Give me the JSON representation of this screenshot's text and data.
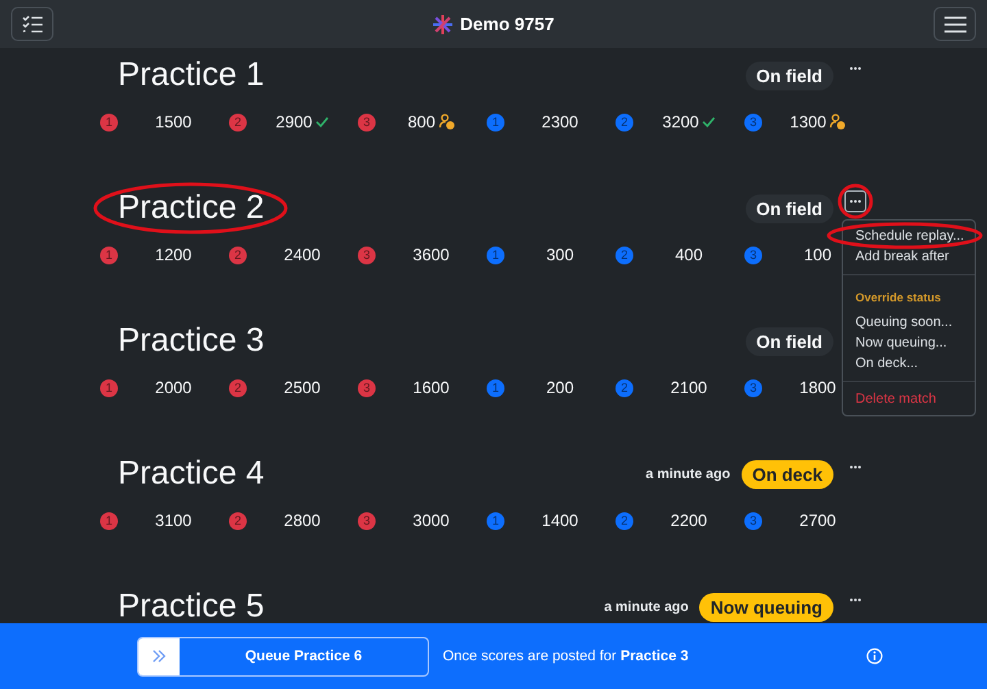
{
  "header": {
    "title": "Demo 9757"
  },
  "matches": [
    {
      "title": "Practice 1",
      "title_circled": false,
      "status": {
        "label": "On field",
        "kind": "dark"
      },
      "menu_open": false,
      "menu_circled": false,
      "scores": [
        {
          "color": "#dc3545",
          "station": "1",
          "value": "1500",
          "kind": "plain"
        },
        {
          "color": "#dc3545",
          "station": "2",
          "value": "2900",
          "kind": "check"
        },
        {
          "color": "#dc3545",
          "station": "3",
          "value": "800",
          "kind": "person"
        },
        {
          "color": "#0d6efd",
          "station": "1",
          "value": "2300",
          "kind": "plain"
        },
        {
          "color": "#0d6efd",
          "station": "2",
          "value": "3200",
          "kind": "check"
        },
        {
          "color": "#0d6efd",
          "station": "3",
          "value": "1300",
          "kind": "person"
        }
      ]
    },
    {
      "title": "Practice 2",
      "title_circled": true,
      "status": {
        "label": "On field",
        "kind": "dark"
      },
      "menu_open": true,
      "menu_circled": true,
      "scores": [
        {
          "color": "#dc3545",
          "station": "1",
          "value": "1200",
          "kind": "plain"
        },
        {
          "color": "#dc3545",
          "station": "2",
          "value": "2400",
          "kind": "plain"
        },
        {
          "color": "#dc3545",
          "station": "3",
          "value": "3600",
          "kind": "plain"
        },
        {
          "color": "#0d6efd",
          "station": "1",
          "value": "300",
          "kind": "plain"
        },
        {
          "color": "#0d6efd",
          "station": "2",
          "value": "400",
          "kind": "plain"
        },
        {
          "color": "#0d6efd",
          "station": "3",
          "value": "100",
          "kind": "plain"
        }
      ]
    },
    {
      "title": "Practice 3",
      "title_circled": false,
      "status": {
        "label": "On field",
        "kind": "dark"
      },
      "scores": [
        {
          "color": "#dc3545",
          "station": "1",
          "value": "2000",
          "kind": "plain"
        },
        {
          "color": "#dc3545",
          "station": "2",
          "value": "2500",
          "kind": "plain"
        },
        {
          "color": "#dc3545",
          "station": "3",
          "value": "1600",
          "kind": "plain"
        },
        {
          "color": "#0d6efd",
          "station": "1",
          "value": "200",
          "kind": "plain"
        },
        {
          "color": "#0d6efd",
          "station": "2",
          "value": "2100",
          "kind": "plain"
        },
        {
          "color": "#0d6efd",
          "station": "3",
          "value": "1800",
          "kind": "plain"
        }
      ]
    },
    {
      "title": "Practice 4",
      "title_circled": false,
      "time": "a minute ago",
      "status": {
        "label": "On deck",
        "kind": "yellow"
      },
      "menu_open": false,
      "menu_circled": false,
      "scores": [
        {
          "color": "#dc3545",
          "station": "1",
          "value": "3100",
          "kind": "plain"
        },
        {
          "color": "#dc3545",
          "station": "2",
          "value": "2800",
          "kind": "plain"
        },
        {
          "color": "#dc3545",
          "station": "3",
          "value": "3000",
          "kind": "plain"
        },
        {
          "color": "#0d6efd",
          "station": "1",
          "value": "1400",
          "kind": "plain"
        },
        {
          "color": "#0d6efd",
          "station": "2",
          "value": "2200",
          "kind": "plain"
        },
        {
          "color": "#0d6efd",
          "station": "3",
          "value": "2700",
          "kind": "plain"
        }
      ]
    },
    {
      "title": "Practice 5",
      "title_circled": false,
      "time": "a minute ago",
      "status": {
        "label": "Now queuing",
        "kind": "yellow"
      },
      "menu_open": false,
      "menu_circled": false
    }
  ],
  "menu": [
    {
      "kind": "action",
      "label": "Schedule replay...",
      "circled": true
    },
    {
      "kind": "action",
      "label": "Add break after",
      "circled": false
    },
    {
      "kind": "divider"
    },
    {
      "kind": "header",
      "label": "Override status"
    },
    {
      "kind": "action",
      "label": "Queuing soon...",
      "circled": false
    },
    {
      "kind": "action",
      "label": "Now queuing...",
      "circled": false
    },
    {
      "kind": "action",
      "label": "On deck...",
      "circled": false
    },
    {
      "kind": "divider"
    },
    {
      "kind": "danger",
      "label": "Delete match",
      "circled": false
    }
  ],
  "footer": {
    "button": "Queue Practice 6",
    "note": "Once scores are posted for **Practice 3**"
  }
}
